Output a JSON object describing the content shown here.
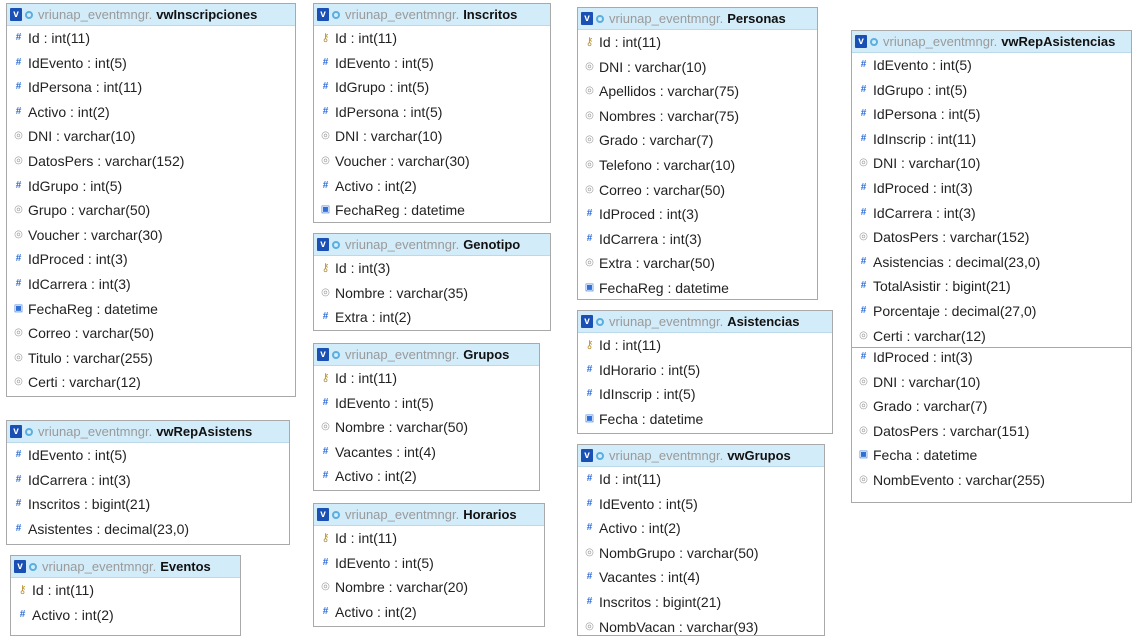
{
  "schema_prefix": "vriunap_eventmngr.",
  "tables": {
    "vwInscripciones": {
      "name": "vwInscripciones",
      "fields": [
        {
          "icon": "number-icon",
          "label": "Id : int(11)"
        },
        {
          "icon": "number-icon",
          "label": "IdEvento : int(5)"
        },
        {
          "icon": "number-icon",
          "label": "IdPersona : int(11)"
        },
        {
          "icon": "number-icon",
          "label": "Activo : int(2)"
        },
        {
          "icon": "text-icon",
          "label": "DNI : varchar(10)"
        },
        {
          "icon": "text-icon",
          "label": "DatosPers : varchar(152)"
        },
        {
          "icon": "number-icon",
          "label": "IdGrupo : int(5)"
        },
        {
          "icon": "text-icon",
          "label": "Grupo : varchar(50)"
        },
        {
          "icon": "text-icon",
          "label": "Voucher : varchar(30)"
        },
        {
          "icon": "number-icon",
          "label": "IdProced : int(3)"
        },
        {
          "icon": "number-icon",
          "label": "IdCarrera : int(3)"
        },
        {
          "icon": "date-icon",
          "label": "FechaReg : datetime"
        },
        {
          "icon": "text-icon",
          "label": "Correo : varchar(50)"
        },
        {
          "icon": "text-icon",
          "label": "Titulo : varchar(255)"
        },
        {
          "icon": "text-icon",
          "label": "Certi : varchar(12)"
        }
      ]
    },
    "vwRepAsistens": {
      "name": "vwRepAsistens",
      "fields": [
        {
          "icon": "number-icon",
          "label": "IdEvento : int(5)"
        },
        {
          "icon": "number-icon",
          "label": "IdCarrera : int(3)"
        },
        {
          "icon": "number-icon",
          "label": "Inscritos : bigint(21)"
        },
        {
          "icon": "number-icon",
          "label": "Asistentes : decimal(23,0)"
        }
      ]
    },
    "Eventos": {
      "name": "Eventos",
      "fields": [
        {
          "icon": "key-icon",
          "label": "Id : int(11)"
        },
        {
          "icon": "number-icon",
          "label": "Activo : int(2)"
        }
      ]
    },
    "Inscritos": {
      "name": "Inscritos",
      "fields": [
        {
          "icon": "key-icon",
          "label": "Id : int(11)"
        },
        {
          "icon": "number-icon",
          "label": "IdEvento : int(5)"
        },
        {
          "icon": "number-icon",
          "label": "IdGrupo : int(5)"
        },
        {
          "icon": "number-icon",
          "label": "IdPersona : int(5)"
        },
        {
          "icon": "text-icon",
          "label": "DNI : varchar(10)"
        },
        {
          "icon": "text-icon",
          "label": "Voucher : varchar(30)"
        },
        {
          "icon": "number-icon",
          "label": "Activo : int(2)"
        },
        {
          "icon": "date-icon",
          "label": "FechaReg : datetime"
        }
      ]
    },
    "Genotipo": {
      "name": "Genotipo",
      "fields": [
        {
          "icon": "key-icon",
          "label": "Id : int(3)"
        },
        {
          "icon": "text-icon",
          "label": "Nombre : varchar(35)"
        },
        {
          "icon": "number-icon",
          "label": "Extra : int(2)"
        }
      ]
    },
    "Grupos": {
      "name": "Grupos",
      "fields": [
        {
          "icon": "key-icon",
          "label": "Id : int(11)"
        },
        {
          "icon": "number-icon",
          "label": "IdEvento : int(5)"
        },
        {
          "icon": "text-icon",
          "label": "Nombre : varchar(50)"
        },
        {
          "icon": "number-icon",
          "label": "Vacantes : int(4)"
        },
        {
          "icon": "number-icon",
          "label": "Activo : int(2)"
        }
      ]
    },
    "Horarios": {
      "name": "Horarios",
      "fields": [
        {
          "icon": "key-icon",
          "label": "Id : int(11)"
        },
        {
          "icon": "number-icon",
          "label": "IdEvento : int(5)"
        },
        {
          "icon": "text-icon",
          "label": "Nombre : varchar(20)"
        },
        {
          "icon": "number-icon",
          "label": "Activo : int(2)"
        }
      ]
    },
    "Personas": {
      "name": "Personas",
      "fields": [
        {
          "icon": "key-icon",
          "label": "Id : int(11)"
        },
        {
          "icon": "text-icon",
          "label": "DNI : varchar(10)"
        },
        {
          "icon": "text-icon",
          "label": "Apellidos : varchar(75)"
        },
        {
          "icon": "text-icon",
          "label": "Nombres : varchar(75)"
        },
        {
          "icon": "text-icon",
          "label": "Grado : varchar(7)"
        },
        {
          "icon": "text-icon",
          "label": "Telefono : varchar(10)"
        },
        {
          "icon": "text-icon",
          "label": "Correo : varchar(50)"
        },
        {
          "icon": "number-icon",
          "label": "IdProced : int(3)"
        },
        {
          "icon": "number-icon",
          "label": "IdCarrera : int(3)"
        },
        {
          "icon": "text-icon",
          "label": "Extra : varchar(50)"
        },
        {
          "icon": "date-icon",
          "label": "FechaReg : datetime"
        }
      ]
    },
    "Asistencias": {
      "name": "Asistencias",
      "fields": [
        {
          "icon": "key-icon",
          "label": "Id : int(11)"
        },
        {
          "icon": "number-icon",
          "label": "IdHorario : int(5)"
        },
        {
          "icon": "number-icon",
          "label": "IdInscrip : int(5)"
        },
        {
          "icon": "date-icon",
          "label": "Fecha : datetime"
        }
      ]
    },
    "vwGrupos": {
      "name": "vwGrupos",
      "fields": [
        {
          "icon": "number-icon",
          "label": "Id : int(11)"
        },
        {
          "icon": "number-icon",
          "label": "IdEvento : int(5)"
        },
        {
          "icon": "number-icon",
          "label": "Activo : int(2)"
        },
        {
          "icon": "text-icon",
          "label": "NombGrupo : varchar(50)"
        },
        {
          "icon": "number-icon",
          "label": "Vacantes : int(4)"
        },
        {
          "icon": "number-icon",
          "label": "Inscritos : bigint(21)"
        },
        {
          "icon": "text-icon",
          "label": "NombVacan : varchar(93)"
        }
      ]
    },
    "vwRepAsistencias": {
      "name": "vwRepAsistencias",
      "fields": [
        {
          "icon": "number-icon",
          "label": "IdEvento : int(5)"
        },
        {
          "icon": "number-icon",
          "label": "IdGrupo : int(5)"
        },
        {
          "icon": "number-icon",
          "label": "IdPersona : int(5)"
        },
        {
          "icon": "number-icon",
          "label": "IdInscrip : int(11)"
        },
        {
          "icon": "text-icon",
          "label": "DNI : varchar(10)"
        },
        {
          "icon": "number-icon",
          "label": "IdProced : int(3)"
        },
        {
          "icon": "number-icon",
          "label": "IdCarrera : int(3)"
        },
        {
          "icon": "text-icon",
          "label": "DatosPers : varchar(152)"
        },
        {
          "icon": "number-icon",
          "label": "Asistencias : decimal(23,0)"
        },
        {
          "icon": "number-icon",
          "label": "TotalAsistir : bigint(21)"
        },
        {
          "icon": "number-icon",
          "label": "Porcentaje : decimal(27,0)"
        },
        {
          "icon": "text-icon",
          "label": "Certi : varchar(12)"
        }
      ]
    },
    "vwRepAsistencias_cont": {
      "fields": [
        {
          "icon": "number-icon",
          "label": "IdProced : int(3)"
        },
        {
          "icon": "text-icon",
          "label": "DNI : varchar(10)"
        },
        {
          "icon": "text-icon",
          "label": "Grado : varchar(7)"
        },
        {
          "icon": "text-icon",
          "label": "DatosPers : varchar(151)"
        },
        {
          "icon": "date-icon",
          "label": "Fecha : datetime"
        },
        {
          "icon": "text-icon",
          "label": "NombEvento : varchar(255)"
        }
      ]
    }
  }
}
